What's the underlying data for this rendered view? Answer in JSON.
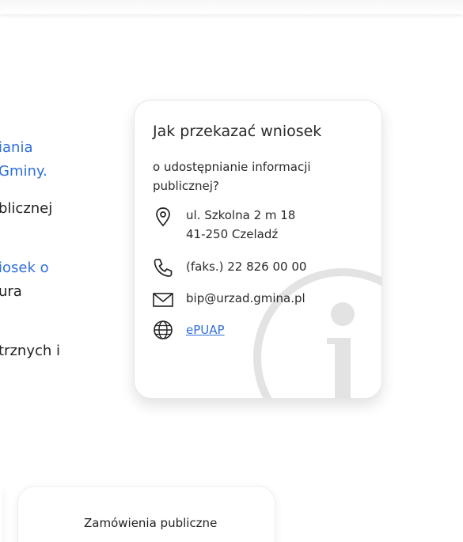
{
  "background_text": {
    "line1": "iania",
    "line2": "Gminy.",
    "line3": "blicznej",
    "line4": "iosek o",
    "line5": "ura",
    "line6": "trznych i"
  },
  "info_card": {
    "title": "Jak przekazać wniosek",
    "subtitle": "o udostępnianie informacji publicznej?",
    "address_line1": "ul. Szkolna 2 m 18",
    "address_line2": "41-250 Czeladź",
    "phone": "(faks.) 22 826 00 00",
    "email": "bip@urzad.gmina.pl",
    "epuap": "ePUAP",
    "icons": {
      "address": "location-pin-icon",
      "phone": "phone-icon",
      "email": "envelope-icon",
      "epuap": "globe-icon",
      "background": "info-icon"
    }
  },
  "bottom_card": {
    "label": "Zamówienia publiczne"
  },
  "colors": {
    "link": "#2f6fdc",
    "text": "#2a2a2a",
    "watermark": "#e3e3e3"
  }
}
